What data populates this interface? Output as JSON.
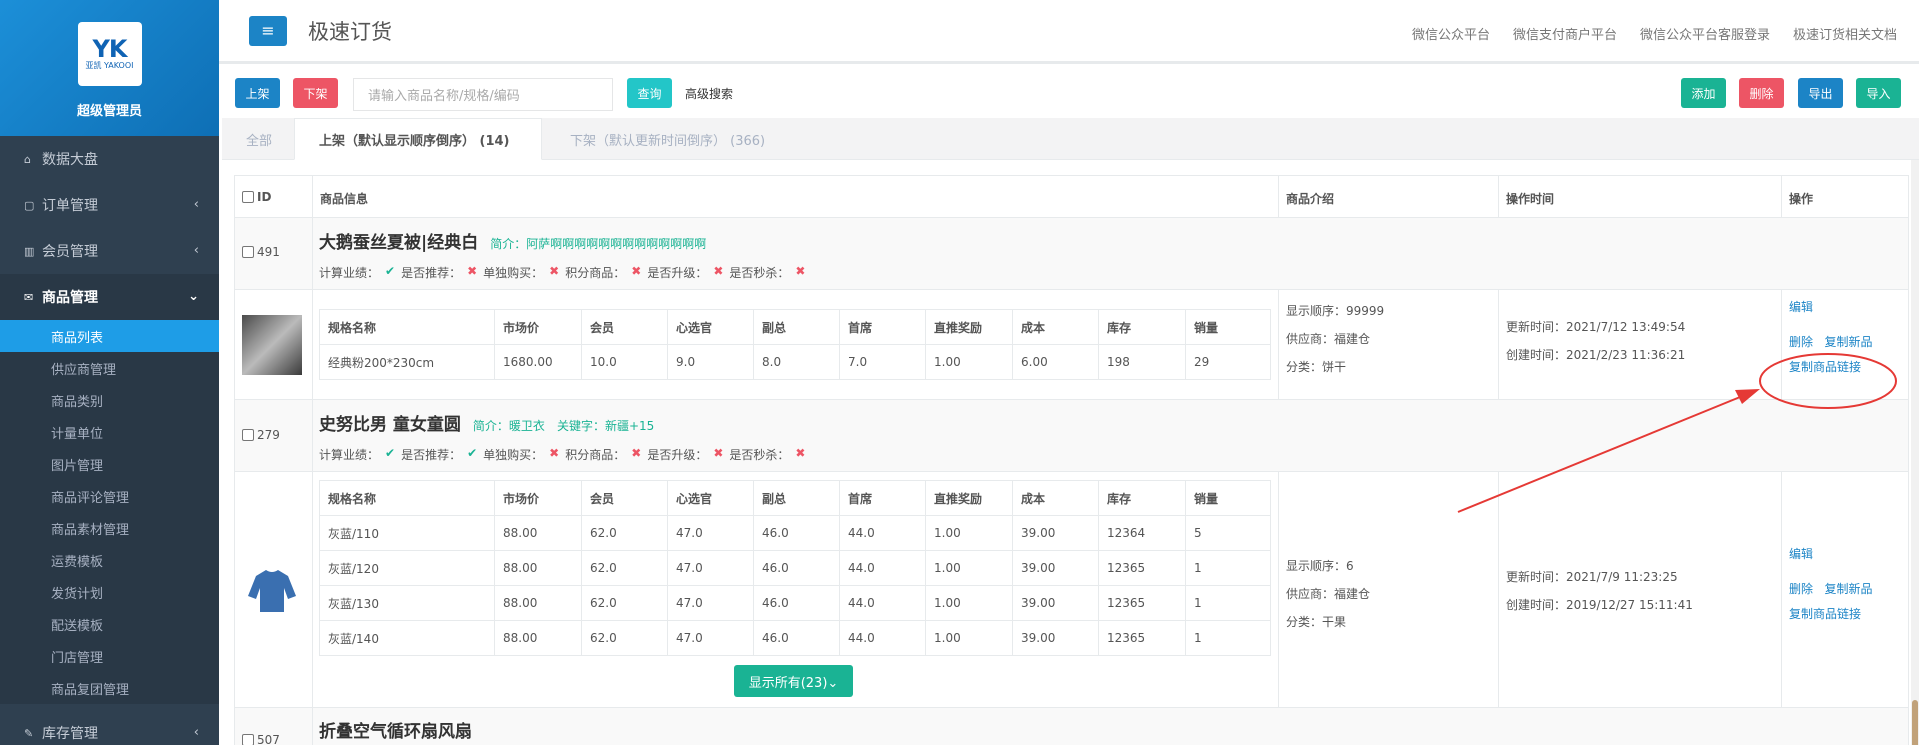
{
  "sidebar": {
    "logo_mark": "YK",
    "logo_sub": "亚凯 YAKOOI",
    "user": "超级管理员",
    "items": [
      {
        "icon": "⌂",
        "label": "数据大盘"
      },
      {
        "icon": "▢",
        "label": "订单管理",
        "chev": "‹"
      },
      {
        "icon": "▥",
        "label": "会员管理",
        "chev": "‹"
      },
      {
        "icon": "✉",
        "label": "商品管理",
        "chev": "⌄"
      }
    ],
    "sub": [
      "商品列表",
      "供应商管理",
      "商品类别",
      "计量单位",
      "图片管理",
      "商品评论管理",
      "商品素材管理",
      "运费模板",
      "发货计划",
      "配送模板",
      "门店管理",
      "商品复团管理"
    ],
    "bottom": {
      "icon": "✎",
      "label": "库存管理",
      "chev": "‹"
    }
  },
  "header": {
    "menu_icon": "≡",
    "title": "极速订货",
    "links": [
      "微信公众平台",
      "微信支付商户平台",
      "微信公众平台客服登录",
      "极速订货相关文档"
    ]
  },
  "toolbar": {
    "up": "上架",
    "down": "下架",
    "search_placeholder": "请输入商品名称/规格/编码",
    "query": "查询",
    "advanced": "高级搜索",
    "add": "添加",
    "delete": "删除",
    "export": "导出",
    "import": "导入"
  },
  "tabs": [
    "全部",
    "上架（默认显示顺序倒序） (14)",
    "下架（默认更新时间倒序） (366)"
  ],
  "table_header": {
    "id": "ID",
    "info": "商品信息",
    "intro": "商品介绍",
    "time": "操作时间",
    "ops": "操作"
  },
  "spec_headers": [
    "规格名称",
    "市场价",
    "会员",
    "心选官",
    "副总",
    "首席",
    "直推奖励",
    "成本",
    "库存",
    "销量"
  ],
  "products": [
    {
      "id": "491",
      "name": "大鹅蚕丝夏被|经典白",
      "intro": "简介：阿萨啊啊啊啊啊啊啊啊啊啊啊啊啊",
      "keyword": "",
      "flags": [
        {
          "label": "计算业绩：",
          "v": "✔"
        },
        {
          "label": "是否推荐：",
          "v": "✖"
        },
        {
          "label": "单独购买：",
          "v": "✖"
        },
        {
          "label": "积分商品：",
          "v": "✖"
        },
        {
          "label": "是否升级：",
          "v": "✖"
        },
        {
          "label": "是否秒杀：",
          "v": "✖"
        }
      ],
      "specs": [
        [
          "经典粉200*230cm",
          "1680.00",
          "10.0",
          "9.0",
          "8.0",
          "7.0",
          "1.00",
          "6.00",
          "198",
          "29"
        ]
      ],
      "order": "显示顺序：99999",
      "supplier": "供应商：福建仓",
      "category": "分类：饼干",
      "updated": "更新时间：2021/7/12 13:49:54",
      "created": "创建时间：2021/2/23 11:36:21"
    },
    {
      "id": "279",
      "name": "史努比男 童女童圆",
      "intro": "简介：暖卫衣",
      "keyword": "关键字：新疆+15",
      "flags": [
        {
          "label": "计算业绩：",
          "v": "✔"
        },
        {
          "label": "是否推荐：",
          "v": "✔"
        },
        {
          "label": "单独购买：",
          "v": "✖"
        },
        {
          "label": "积分商品：",
          "v": "✖"
        },
        {
          "label": "是否升级：",
          "v": "✖"
        },
        {
          "label": "是否秒杀：",
          "v": "✖"
        }
      ],
      "specs": [
        [
          "灰蓝/110",
          "88.00",
          "62.0",
          "47.0",
          "46.0",
          "44.0",
          "1.00",
          "39.00",
          "12364",
          "5"
        ],
        [
          "灰蓝/120",
          "88.00",
          "62.0",
          "47.0",
          "46.0",
          "44.0",
          "1.00",
          "39.00",
          "12365",
          "1"
        ],
        [
          "灰蓝/130",
          "88.00",
          "62.0",
          "47.0",
          "46.0",
          "44.0",
          "1.00",
          "39.00",
          "12365",
          "1"
        ],
        [
          "灰蓝/140",
          "88.00",
          "62.0",
          "47.0",
          "46.0",
          "44.0",
          "1.00",
          "39.00",
          "12365",
          "1"
        ]
      ],
      "order": "显示顺序：6",
      "supplier": "供应商：福建仓",
      "category": "分类：干果",
      "updated": "更新时间：2021/7/9 11:23:25",
      "created": "创建时间：2019/12/27 15:11:41",
      "show_all": "显示所有(23)⌄"
    },
    {
      "id": "507",
      "name": "折叠空气循环扇风扇"
    }
  ],
  "ops": {
    "edit": "编辑",
    "delete": "删除",
    "copy": "复制新品",
    "copy_link": "复制商品链接"
  },
  "colors": {
    "sidebar": "#2f4050",
    "active": "#1e9de7",
    "teal": "#1ab394",
    "red": "#ed5565",
    "blue": "#1c84c6",
    "annotation": "#e53935"
  }
}
